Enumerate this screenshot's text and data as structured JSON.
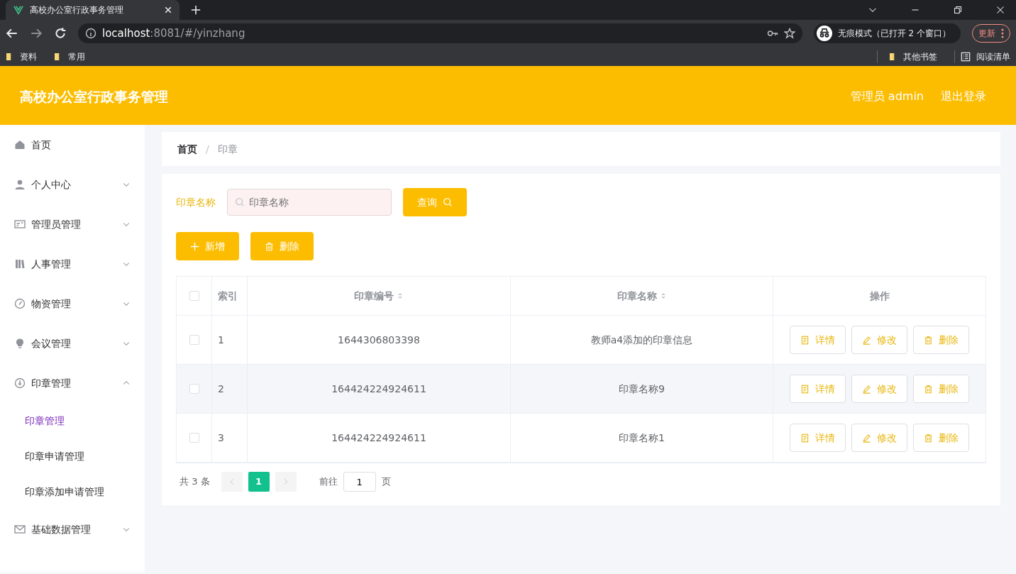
{
  "browser": {
    "tab_title": "高校办公室行政事务管理",
    "address": {
      "host": "localhost",
      "rest": ":8081/#/yinzhang"
    },
    "incognito_label": "无痕模式（已打开 2 个窗口）",
    "update_button": "更新",
    "bookmarks": [
      "资料",
      "常用"
    ],
    "other_bookmarks": "其他书签",
    "reading_list": "阅读清单"
  },
  "header": {
    "title": "高校办公室行政事务管理",
    "user": "管理员 admin",
    "logout": "退出登录"
  },
  "sidebar": {
    "items": [
      {
        "label": "首页",
        "kind": "home"
      },
      {
        "label": "个人中心",
        "kind": "user",
        "expanded": false
      },
      {
        "label": "管理员管理",
        "kind": "card",
        "expanded": false
      },
      {
        "label": "人事管理",
        "kind": "books",
        "expanded": false
      },
      {
        "label": "物资管理",
        "kind": "compass",
        "expanded": false
      },
      {
        "label": "会议管理",
        "kind": "bulb",
        "expanded": false
      },
      {
        "label": "印章管理",
        "kind": "gauge",
        "expanded": true,
        "children": [
          {
            "label": "印章管理",
            "selected": true
          },
          {
            "label": "印章申请管理",
            "selected": false
          },
          {
            "label": "印章添加申请管理",
            "selected": false
          }
        ]
      },
      {
        "label": "基础数据管理",
        "kind": "mail",
        "expanded": false
      }
    ]
  },
  "breadcrumb": {
    "separator": "/",
    "items": [
      {
        "label": "首页",
        "current": false
      },
      {
        "label": "印章",
        "current": true
      }
    ]
  },
  "search": {
    "label": "印章名称",
    "placeholder": "印章名称",
    "button": "查询"
  },
  "actions": [
    {
      "label": "新增",
      "kind": "add"
    },
    {
      "label": "删除",
      "kind": "delete"
    }
  ],
  "table": {
    "select_all_checked": false,
    "columns": [
      {
        "label": "索引",
        "sortable": false
      },
      {
        "label": "印章编号",
        "sortable": true
      },
      {
        "label": "印章名称",
        "sortable": true
      },
      {
        "label": "操作",
        "sortable": false
      }
    ],
    "rows": [
      {
        "index": "1",
        "number": "1644306803398",
        "name": "教师a4添加的印章信息",
        "checked": false,
        "actions": [
          "详情",
          "修改",
          "删除"
        ]
      },
      {
        "index": "2",
        "number": "164424224924611",
        "name": "印章名称9",
        "checked": false,
        "actions": [
          "详情",
          "修改",
          "删除"
        ]
      },
      {
        "index": "3",
        "number": "164424224924611",
        "name": "印章名称1",
        "checked": false,
        "actions": [
          "详情",
          "修改",
          "删除"
        ]
      }
    ]
  },
  "pagination": {
    "total": "共 3 条",
    "pages": [
      {
        "label": "1",
        "selected": true
      }
    ],
    "goto_label": "前往",
    "goto_value": "1",
    "goto_suffix": "页"
  }
}
